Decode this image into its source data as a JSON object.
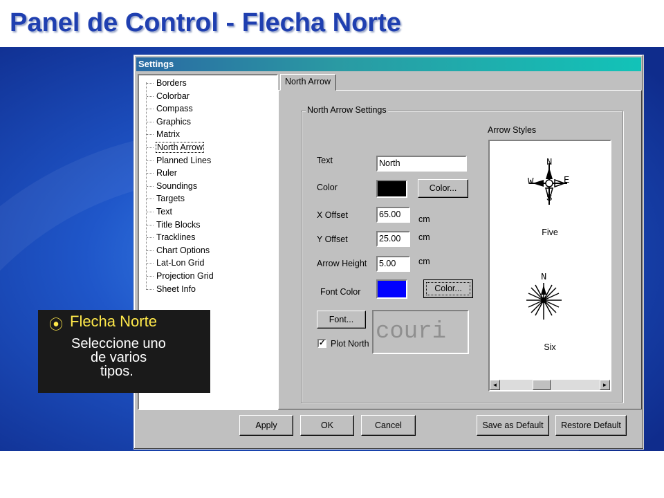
{
  "slide": {
    "title": "Panel de Control - Flecha Norte"
  },
  "dialog": {
    "title": "Settings",
    "tree_items": [
      "Borders",
      "Colorbar",
      "Compass",
      "Graphics",
      "Matrix",
      "North Arrow",
      "Planned Lines",
      "Ruler",
      "Soundings",
      "Targets",
      "Text",
      "Title Blocks",
      "Tracklines",
      "Chart Options",
      "Lat-Lon Grid",
      "Projection Grid",
      "Sheet Info"
    ],
    "selected_tree_item": "North Arrow",
    "tab_label": "North Arrow",
    "group_label": "North Arrow Settings",
    "fields": {
      "text_label": "Text",
      "text_value": "North",
      "color_label": "Color",
      "color_value": "#000000",
      "color_button": "Color...",
      "x_offset_label": "X Offset",
      "x_offset_value": "65.00",
      "x_offset_unit": "cm",
      "y_offset_label": "Y Offset",
      "y_offset_value": "25.00",
      "y_offset_unit": "cm",
      "arrow_height_label": "Arrow Height",
      "arrow_height_value": "5.00",
      "arrow_height_unit": "cm",
      "font_color_label": "Font Color",
      "font_color_value": "#0000ff",
      "font_color_button": "Color...",
      "font_button": "Font...",
      "font_preview": "couri",
      "plot_north_label": "Plot North",
      "plot_north_checked": "✓"
    },
    "arrow_styles": {
      "label": "Arrow Styles",
      "items": [
        {
          "name": "Five",
          "letters": {
            "n": "N",
            "s": "S",
            "e": "E",
            "w": "W"
          }
        },
        {
          "name": "Six",
          "letters": {
            "n": "N"
          }
        }
      ],
      "scroll_left_icon": "◄",
      "scroll_right_icon": "►"
    },
    "buttons": {
      "apply": "Apply",
      "ok": "OK",
      "cancel": "Cancel",
      "save_default": "Save as Default",
      "restore_default": "Restore Default"
    }
  },
  "callout": {
    "bullet_icon": "⦿",
    "heading": "Flecha Norte",
    "body_lines": [
      "Seleccione uno",
      "de varios",
      "tipos."
    ]
  }
}
